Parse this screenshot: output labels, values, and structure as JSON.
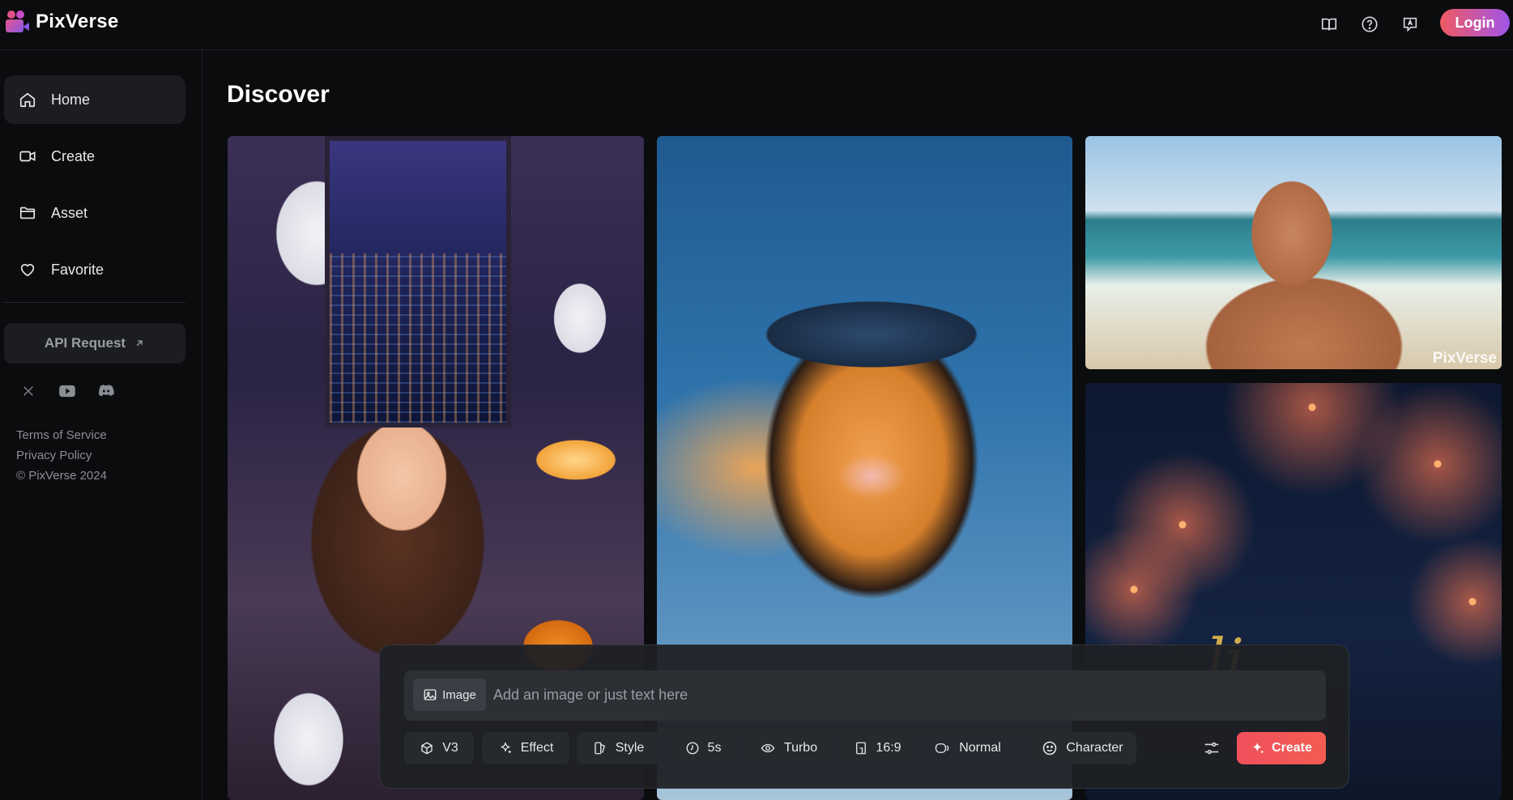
{
  "app": {
    "name": "PixVerse",
    "brand_gradient": [
      "#f05a62",
      "#a055e8"
    ]
  },
  "topbar": {
    "icons": [
      "book-icon",
      "help-icon",
      "translate-icon"
    ],
    "login_label": "Login"
  },
  "sidebar": {
    "items": [
      {
        "label": "Home",
        "icon": "home-icon",
        "active": true
      },
      {
        "label": "Create",
        "icon": "video-camera-icon",
        "active": false
      },
      {
        "label": "Asset",
        "icon": "folder-icon",
        "active": false
      },
      {
        "label": "Favorite",
        "icon": "heart-icon",
        "active": false
      }
    ],
    "api_request_label": "API Request",
    "socials": [
      "x-icon",
      "youtube-icon",
      "discord-icon"
    ],
    "links": {
      "terms": "Terms of Service",
      "privacy": "Privacy Policy",
      "copyright": "© PixVerse 2024"
    }
  },
  "main": {
    "title": "Discover",
    "gallery": [
      {
        "subject": "halloween-office-girl"
      },
      {
        "subject": "skydiving-tiger"
      },
      {
        "subject": "beach-man",
        "watermark": "PixVerse"
      },
      {
        "subject": "fireworks-greeting",
        "overlay_text": "li"
      }
    ]
  },
  "prompt": {
    "image_chip_label": "Image",
    "placeholder": "Add an image or just text here",
    "value": "",
    "options": [
      {
        "label": "V3",
        "icon": "cube-icon"
      },
      {
        "label": "Effect",
        "icon": "sparkle-icon"
      },
      {
        "label": "Style",
        "icon": "style-icon"
      },
      {
        "label": "5s",
        "icon": "clock-icon"
      },
      {
        "label": "Turbo",
        "icon": "eye-icon"
      },
      {
        "label": "16:9",
        "icon": "aspect-ratio-icon"
      },
      {
        "label": "Normal",
        "icon": "motion-icon"
      },
      {
        "label": "Character",
        "icon": "smiley-icon"
      }
    ],
    "create_label": "Create",
    "create_color": "#f0505c"
  }
}
